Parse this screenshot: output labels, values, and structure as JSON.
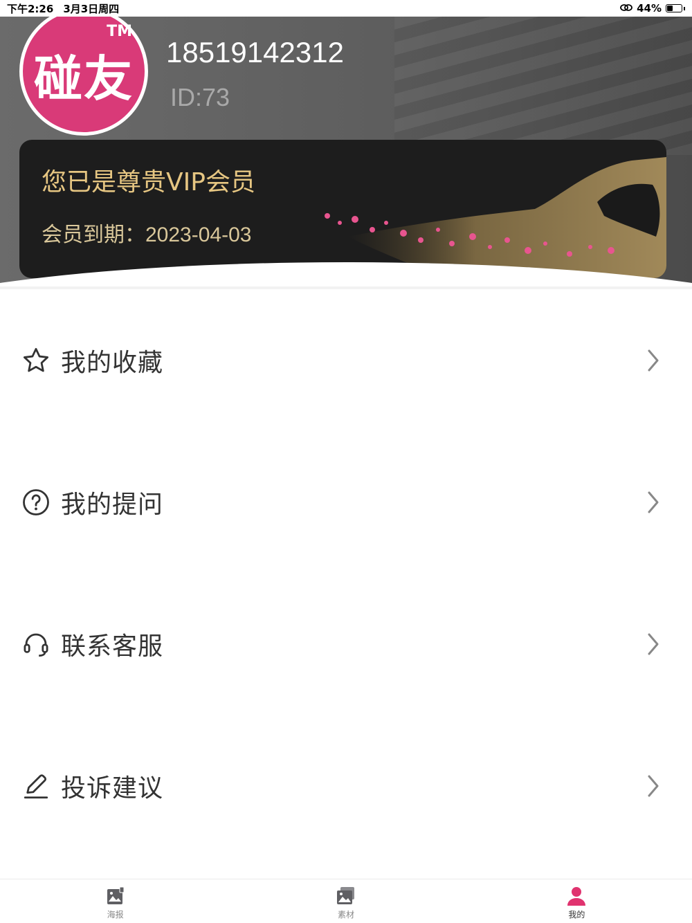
{
  "status_bar": {
    "time": "下午2:26",
    "date": "3月3日周四",
    "battery": "44%",
    "battery_level": 0.44
  },
  "profile": {
    "avatar_text": "碰友",
    "avatar_tm": "TM",
    "phone": "18519142312",
    "id": "ID:73"
  },
  "vip": {
    "title": "您已是尊贵VIP会员",
    "expire": "会员到期：2023-04-03"
  },
  "menu": {
    "items": [
      {
        "label": "我的收藏",
        "icon": "star-icon"
      },
      {
        "label": "我的提问",
        "icon": "question-circle-icon"
      },
      {
        "label": "联系客服",
        "icon": "headset-icon"
      },
      {
        "label": "投诉建议",
        "icon": "edit-icon"
      }
    ]
  },
  "tabbar": {
    "tabs": [
      {
        "label": "海报",
        "icon": "poster-icon",
        "active": false
      },
      {
        "label": "素材",
        "icon": "gallery-icon",
        "active": false
      },
      {
        "label": "我的",
        "icon": "user-icon",
        "active": true
      }
    ]
  },
  "colors": {
    "brand": "#d93a78",
    "vip_gold": "#e6c682",
    "active_tab": "#e0336f"
  }
}
